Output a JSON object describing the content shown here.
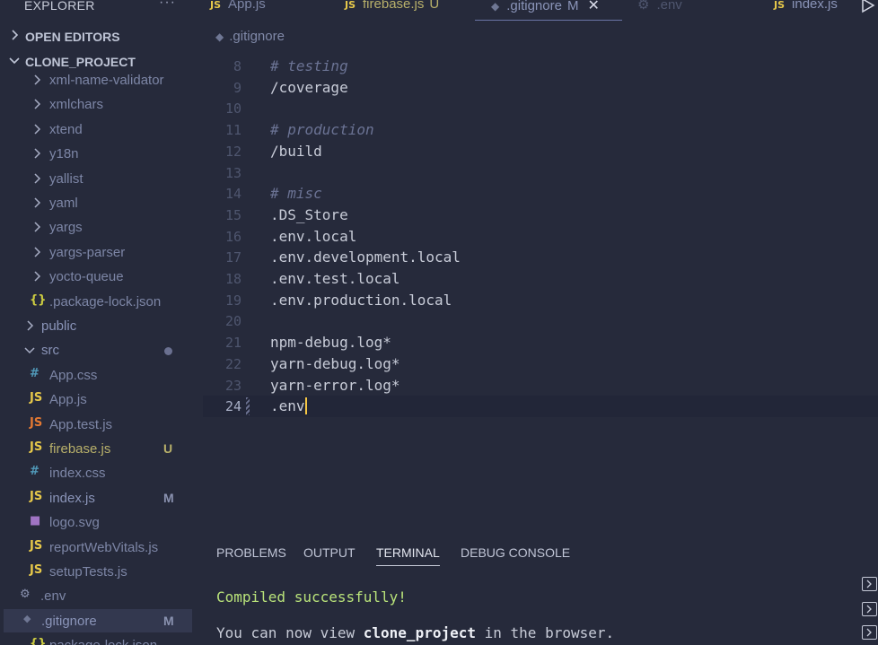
{
  "explorer": {
    "title": "EXPLORER",
    "more": "···",
    "open_editors": "OPEN EDITORS",
    "project": "CLONE_PROJECT"
  },
  "tree": [
    {
      "name": "xml-name-validator",
      "type": "folder"
    },
    {
      "name": "xmlchars",
      "type": "folder"
    },
    {
      "name": "xtend",
      "type": "folder"
    },
    {
      "name": "y18n",
      "type": "folder"
    },
    {
      "name": "yallist",
      "type": "folder"
    },
    {
      "name": "yaml",
      "type": "folder"
    },
    {
      "name": "yargs",
      "type": "folder"
    },
    {
      "name": "yargs-parser",
      "type": "folder"
    },
    {
      "name": "yocto-queue",
      "type": "folder"
    },
    {
      "name": ".package-lock.json",
      "type": "json",
      "icon": "{}"
    },
    {
      "name": "public",
      "type": "folder"
    },
    {
      "name": "src",
      "type": "folder-open"
    },
    {
      "name": "App.css",
      "type": "css",
      "icon": "#"
    },
    {
      "name": "App.js",
      "type": "js",
      "icon": "JS"
    },
    {
      "name": "App.test.js",
      "type": "test",
      "icon": "JS"
    },
    {
      "name": "firebase.js",
      "type": "js",
      "icon": "JS",
      "badge": "U"
    },
    {
      "name": "index.css",
      "type": "css",
      "icon": "#"
    },
    {
      "name": "index.js",
      "type": "js",
      "icon": "JS",
      "badge": "M"
    },
    {
      "name": "logo.svg",
      "type": "svg",
      "icon": "svg"
    },
    {
      "name": "reportWebVitals.js",
      "type": "js",
      "icon": "JS"
    },
    {
      "name": "setupTests.js",
      "type": "js",
      "icon": "JS"
    },
    {
      "name": ".env",
      "type": "env",
      "icon": "⚙"
    },
    {
      "name": ".gitignore",
      "type": "git",
      "icon": "◆",
      "badge": "M"
    },
    {
      "name": "package-lock.json",
      "type": "json",
      "icon": "{}"
    }
  ],
  "tabs": [
    {
      "icon": "JS",
      "name": "App.js",
      "status": ""
    },
    {
      "icon": "JS",
      "name": "firebase.js",
      "status": "U"
    },
    {
      "icon": "◆",
      "name": ".gitignore",
      "status": "M",
      "close": "✕"
    },
    {
      "icon": "⚙",
      "name": ".env",
      "status": ""
    },
    {
      "icon": "JS",
      "name": "index.js",
      "status": ""
    }
  ],
  "breadcrumb": ".gitignore",
  "editor": {
    "lines": [
      {
        "n": "8",
        "text": "# testing",
        "kind": "comment"
      },
      {
        "n": "9",
        "text": "/coverage",
        "kind": "code"
      },
      {
        "n": "10",
        "text": "",
        "kind": "code"
      },
      {
        "n": "11",
        "text": "# production",
        "kind": "comment"
      },
      {
        "n": "12",
        "text": "/build",
        "kind": "code"
      },
      {
        "n": "13",
        "text": "",
        "kind": "code"
      },
      {
        "n": "14",
        "text": "# misc",
        "kind": "comment"
      },
      {
        "n": "15",
        "text": ".DS_Store",
        "kind": "code"
      },
      {
        "n": "16",
        "text": ".env.local",
        "kind": "code"
      },
      {
        "n": "17",
        "text": ".env.development.local",
        "kind": "code"
      },
      {
        "n": "18",
        "text": ".env.test.local",
        "kind": "code"
      },
      {
        "n": "19",
        "text": ".env.production.local",
        "kind": "code"
      },
      {
        "n": "20",
        "text": "",
        "kind": "code"
      },
      {
        "n": "21",
        "text": "npm-debug.log*",
        "kind": "code"
      },
      {
        "n": "22",
        "text": "yarn-debug.log*",
        "kind": "code"
      },
      {
        "n": "23",
        "text": "yarn-error.log*",
        "kind": "code"
      },
      {
        "n": "24",
        "text": ".env",
        "kind": "current"
      }
    ]
  },
  "panel": {
    "tabs": [
      "PROBLEMS",
      "OUTPUT",
      "TERMINAL",
      "DEBUG CONSOLE"
    ],
    "active": "TERMINAL"
  },
  "terminal": {
    "line1": "Compiled successfully!",
    "line2_pre": "You can now view ",
    "line2_bold": "clone_project",
    "line2_post": " in the browser."
  },
  "colors": {
    "background": "#262a3b",
    "js": "#e6c84a",
    "css": "#519aba",
    "test": "#e37933",
    "svg": "#a074c4",
    "git": "#6f7794",
    "env": "#8a92b0",
    "json": "#cbcb41",
    "caret": "#f6c744",
    "terminal_success": "#b9e37a"
  }
}
